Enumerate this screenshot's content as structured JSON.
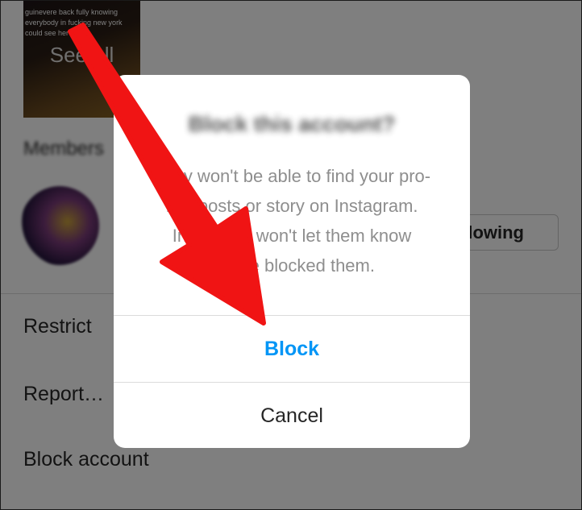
{
  "background": {
    "media": {
      "caption": "guinevere back fully knowing everybody in fucking new york could see her",
      "see_all": "See all"
    },
    "members_label": "Members",
    "member": {
      "following_label": "Following"
    },
    "menu": {
      "restrict": "Restrict",
      "report": "Report…",
      "block_account": "Block account"
    }
  },
  "dialog": {
    "title": "Block this account?",
    "message": "They won't be able to find your profile, posts or story on Instagram. Instagram won't let them know you've blocked them.",
    "message_lines": [
      "They won't be able to find your pro-",
      "file, posts or story on Instagram.",
      "Instagram won't let them know",
      "you've blocked them."
    ],
    "block_label": "Block",
    "cancel_label": "Cancel"
  },
  "colors": {
    "accent_blue": "#0095f6",
    "annotation_red": "#f01414",
    "text_gray": "#8e8e8e",
    "text_dark": "#262626"
  },
  "icons": {
    "annotation": "red-arrow-icon"
  }
}
